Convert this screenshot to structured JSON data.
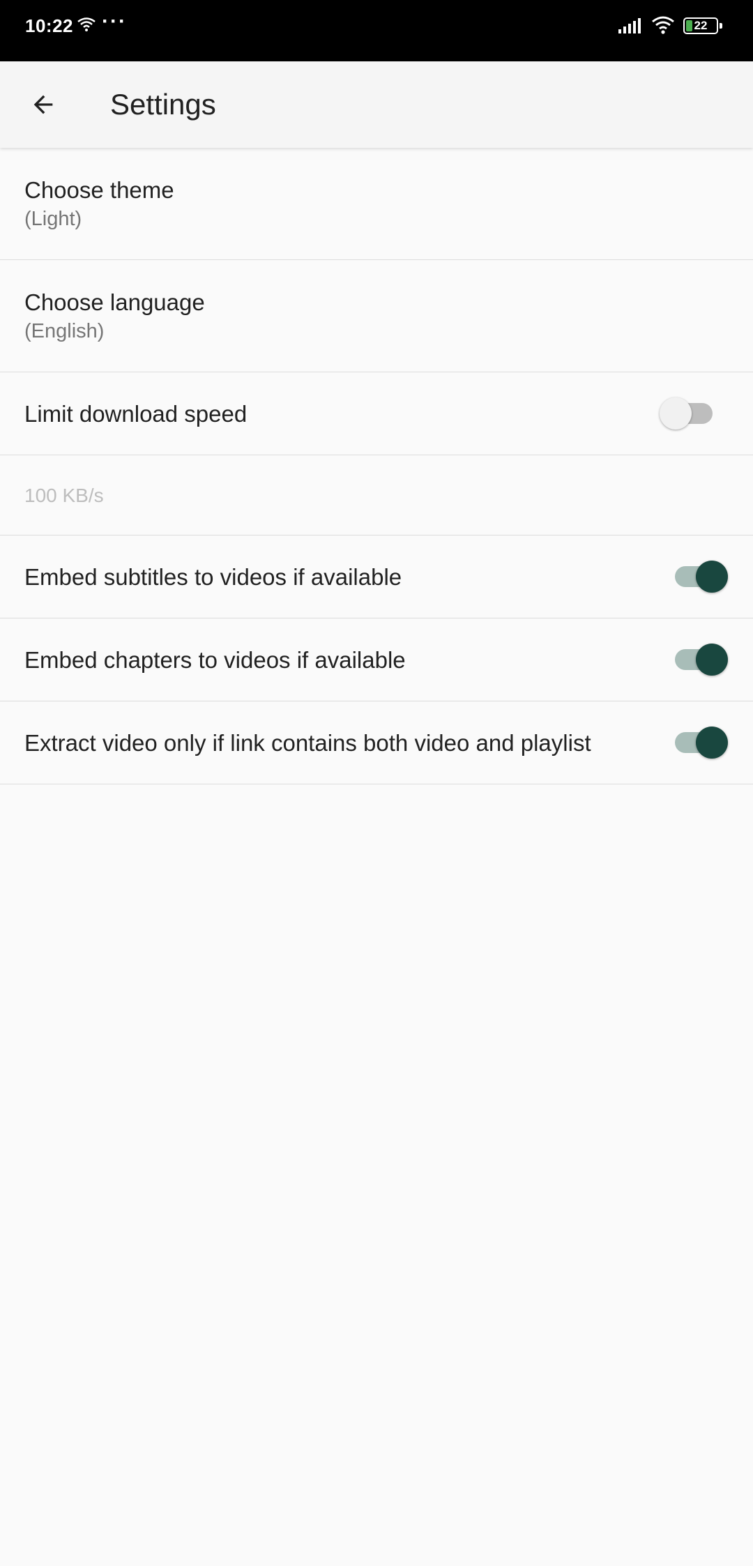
{
  "status_bar": {
    "time": "10:22",
    "more": "···",
    "battery_level": "22",
    "battery_color": "#4caf50"
  },
  "app_bar": {
    "back_icon": "arrow-back-icon",
    "title": "Settings"
  },
  "settings": {
    "theme": {
      "label": "Choose theme",
      "value": "(Light)"
    },
    "language": {
      "label": "Choose language",
      "value": "(English)"
    },
    "limit_speed": {
      "label": "Limit download speed",
      "enabled": false
    },
    "speed_value": "100 KB/s",
    "embed_subtitles": {
      "label": "Embed subtitles to videos if available",
      "enabled": true
    },
    "embed_chapters": {
      "label": "Embed chapters to videos if available",
      "enabled": true
    },
    "extract_video_only": {
      "label": "Extract video only if link contains both video and playlist",
      "enabled": true
    }
  },
  "colors": {
    "accent": "#19473f",
    "accent_track": "#a8bdb8",
    "background": "#fafafa",
    "app_bar": "#f5f5f5"
  }
}
